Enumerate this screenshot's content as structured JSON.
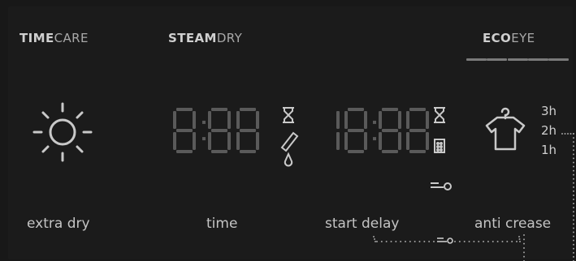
{
  "programs": {
    "timecare": {
      "bold": "TIME",
      "light": "CARE"
    },
    "steamdry": {
      "bold": "STEAM",
      "light": "DRY"
    },
    "ecoeye": {
      "bold": "ECO",
      "light": "EYE"
    }
  },
  "displays": {
    "time_digits": "8:88",
    "delay_digits": "18:88"
  },
  "anti_crease_levels": [
    "3h",
    "2h",
    "1h"
  ],
  "labels": {
    "extra_dry": "extra dry",
    "time": "time",
    "start_delay": "start delay",
    "anti_crease": "anti crease"
  },
  "icons": [
    "sun-icon",
    "hourglass-icon",
    "steam-wand-icon",
    "water-drop-icon",
    "drum-icon",
    "key-lock-icon",
    "shirt-hanger-icon"
  ],
  "colors": {
    "background": "#1b1b1b",
    "text": "#c4c4c4",
    "segment_unlit": "#5a5a5a"
  }
}
